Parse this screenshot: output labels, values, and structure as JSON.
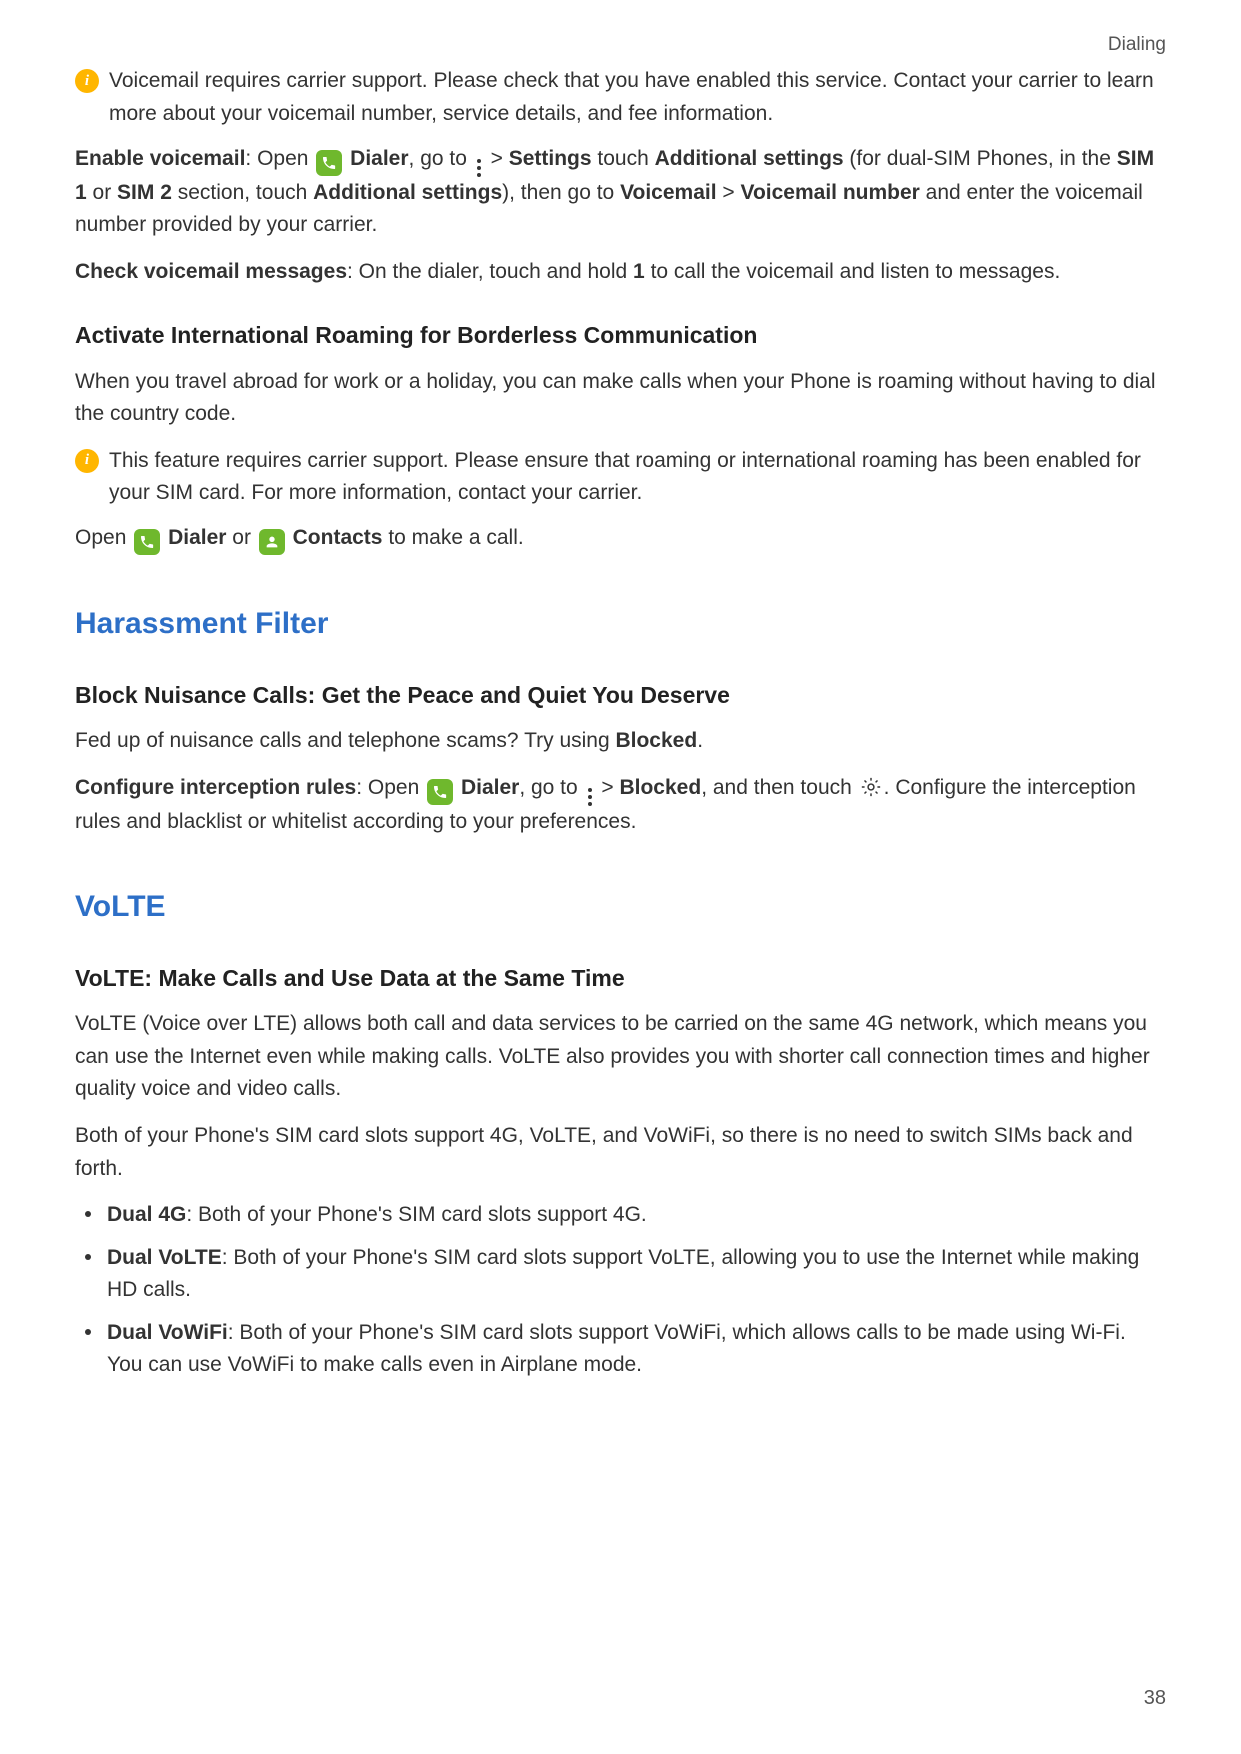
{
  "header": {
    "category": "Dialing"
  },
  "info1": "Voicemail requires carrier support. Please check that you have enabled this service. Contact your carrier to learn more about your voicemail number, service details, and fee information.",
  "enable": {
    "lead": "Enable voicemail",
    "t1": ": Open ",
    "dialer": "Dialer",
    "t2": ", go to ",
    "gt": " > ",
    "settings": "Settings",
    "t3": " touch ",
    "addl": "Additional settings",
    "t4": " (for dual-SIM Phones, in the ",
    "sim1": "SIM 1",
    "or": " or ",
    "sim2": "SIM 2",
    "t5": " section, touch ",
    "addl2": "Additional settings",
    "t6": "), then go to ",
    "vm": "Voicemail",
    "gt2": " > ",
    "vmnum": "Voicemail number",
    "t7": " and enter the voicemail number provided by your carrier."
  },
  "check": {
    "lead": "Check voicemail messages",
    "t1": ": On the dialer, touch and hold ",
    "one": "1",
    "t2": " to call the voicemail and listen to messages."
  },
  "roaming": {
    "heading": "Activate International Roaming for Borderless Communication",
    "p1": "When you travel abroad for work or a holiday, you can make calls when your Phone is roaming without having to dial the country code.",
    "info": "This feature requires carrier support. Please ensure that roaming or international roaming has been enabled for your SIM card. For more information, contact your carrier.",
    "open": "Open ",
    "dialer": "Dialer",
    "or": " or ",
    "contacts": "Contacts",
    "tail": " to make a call."
  },
  "harass": {
    "title": "Harassment Filter",
    "sub": "Block Nuisance Calls: Get the Peace and Quiet You Deserve",
    "p1a": "Fed up of nuisance calls and telephone scams? Try using ",
    "blocked": "Blocked",
    "p1b": ".",
    "cfg_lead": "Configure interception rules",
    "t1": ": Open ",
    "dialer": "Dialer",
    "t2": ", go to ",
    "gt": " > ",
    "blockedb": "Blocked",
    "t3": ", and then touch ",
    "t4": ". Configure the interception rules and blacklist or whitelist according to your preferences."
  },
  "volte": {
    "title": "VoLTE",
    "sub": "VoLTE: Make Calls and Use Data at the Same Time",
    "p1": "VoLTE (Voice over LTE) allows both call and data services to be carried on the same 4G network, which means you can use the Internet even while making calls. VoLTE also provides you with shorter call connection times and higher quality voice and video calls.",
    "p2": "Both of your Phone's SIM card slots support 4G, VoLTE, and VoWiFi, so there is no need to switch SIMs back and forth.",
    "b1_lead": "Dual 4G",
    "b1": ": Both of your Phone's SIM card slots support 4G.",
    "b2_lead": "Dual VoLTE",
    "b2": ": Both of your Phone's SIM card slots support VoLTE, allowing you to use the Internet while making HD calls.",
    "b3_lead": "Dual VoWiFi",
    "b3": ": Both of your Phone's SIM card slots support VoWiFi, which allows calls to be made using Wi-Fi. You can use VoWiFi to make calls even in Airplane mode."
  },
  "pagenum": "38"
}
